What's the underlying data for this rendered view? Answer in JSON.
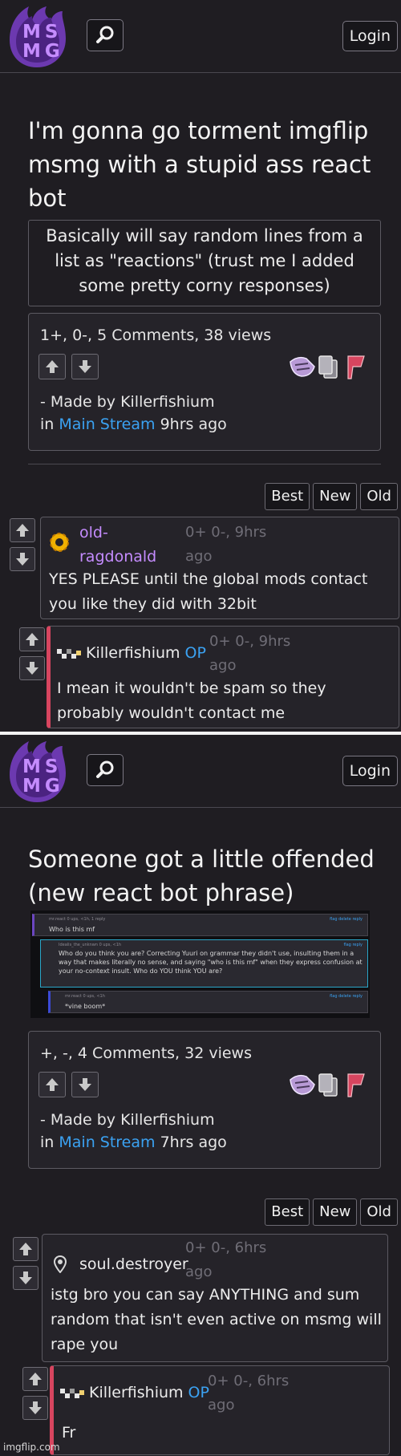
{
  "colors": {
    "accent": "#c58cff",
    "link": "#3ba2f2",
    "op_bar": "#d7455f",
    "bg": "#1f1d22"
  },
  "header": {
    "logo_text": "MS MG",
    "login_label": "Login",
    "search_icon": "search-icon"
  },
  "post1": {
    "title": "I'm gonna go torment imgflip msmg with a stupid ass react bot",
    "description": "Basically will say random lines from a list as \"reactions\" (trust me I added some pretty corny responses)",
    "stats": "1+, 0-, 5 Comments, 38 views",
    "made_by": "- Made by Killerfishium",
    "in_label": "in",
    "stream": "Main Stream",
    "time": "9hrs ago",
    "sort": [
      "Best",
      "New",
      "Old"
    ],
    "comments": [
      {
        "user": "old-ragdonald",
        "meta": "0+ 0-, 9hrs ago",
        "text": "YES PLEASE until the global mods contact you like they did with 32bit"
      },
      {
        "user": "Killerfishium",
        "op": "OP",
        "meta": "0+ 0-, 9hrs ago",
        "text": "I mean it wouldn't be spam so they probably wouldn't contact me"
      }
    ]
  },
  "post2": {
    "title": "Someone got a little offended (new react bot phrase)",
    "embed": {
      "row1_user": "mr.react  0 ups, <1h, 1 reply",
      "row1_text": "Who is this mf",
      "row1_links": "flag  delete  reply",
      "row2_user": "Idealis_the_unknwn  0 ups, <1h",
      "row2_text": "Who do you think you are? Correcting Yuuri on grammar they didn't use, insulting them in a way that makes literally no sense, and saying \"who is this mf\" when they express confusion at your no-context insult. Who do YOU think YOU are?",
      "row2_links": "flag  reply",
      "row3_user": "mr.react  0 ups, <1h",
      "row3_text": "*vine boom*",
      "row3_links": "flag  delete  reply"
    },
    "stats": "+, -, 4 Comments, 32 views",
    "made_by": "- Made by Killerfishium",
    "in_label": "in",
    "stream": "Main Stream",
    "time": "7hrs ago",
    "sort": [
      "Best",
      "New",
      "Old"
    ],
    "comments": [
      {
        "user": "soul.destroyer",
        "meta": "0+ 0-, 6hrs ago",
        "text": "istg bro you can say ANYTHING and sum random that isn't even active on msmg will rape you"
      },
      {
        "user": "Killerfishium",
        "op": "OP",
        "meta": "0+ 0-, 6hrs ago",
        "text": "Fr"
      }
    ]
  },
  "watermark": "imgflip.com"
}
